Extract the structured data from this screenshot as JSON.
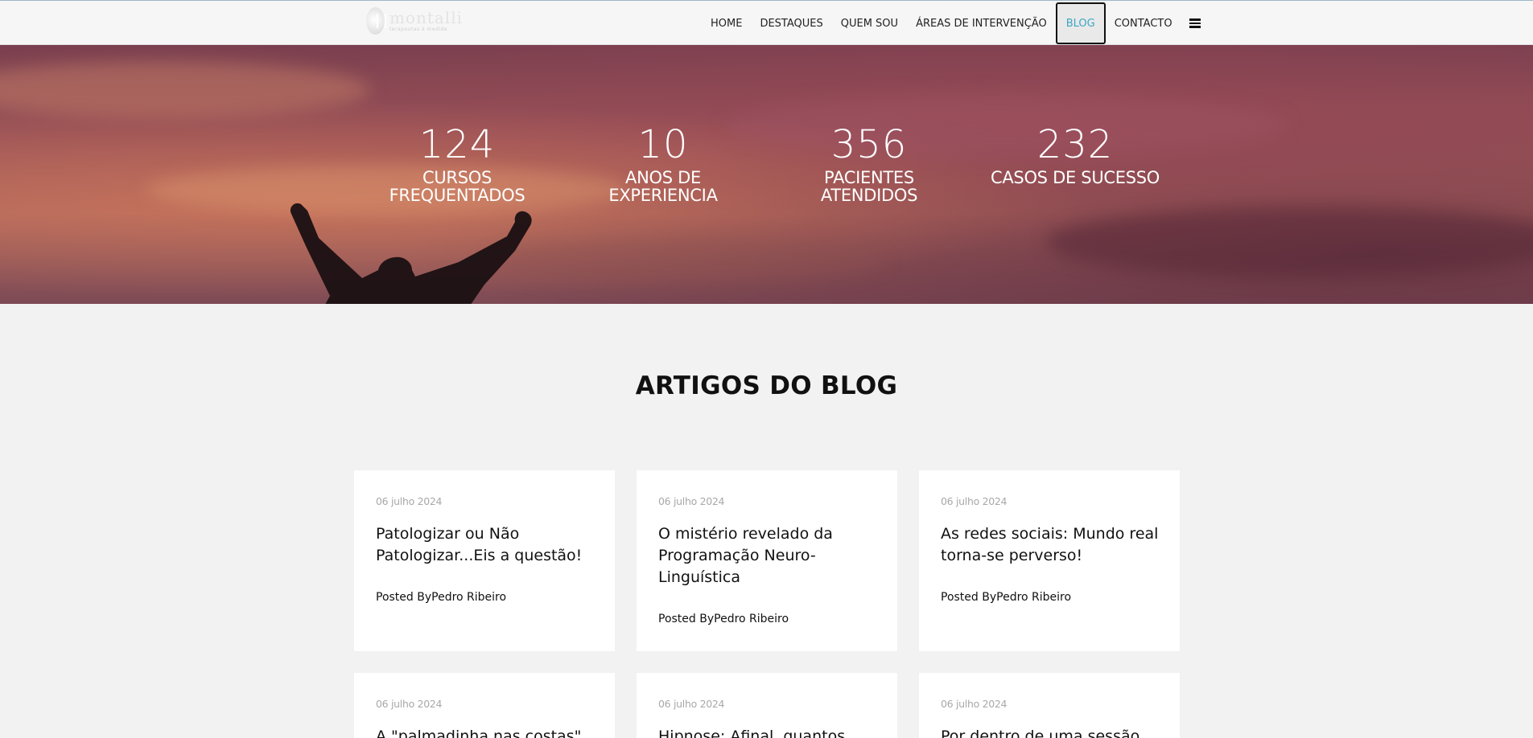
{
  "header": {
    "logo": {
      "name": "montalli",
      "tagline": "terapeutas à medida"
    },
    "nav": [
      {
        "label": "HOME",
        "active": false
      },
      {
        "label": "DESTAQUES",
        "active": false
      },
      {
        "label": "QUEM SOU",
        "active": false
      },
      {
        "label": "ÁREAS DE INTERVENÇÃO",
        "active": false
      },
      {
        "label": "BLOG",
        "active": true
      },
      {
        "label": "CONTACTO",
        "active": false
      }
    ],
    "menu_icon": "hamburger-menu-icon"
  },
  "hero": {
    "stats": [
      {
        "number": "124",
        "label_line1": "CURSOS",
        "label_line2": "FREQUENTADOS"
      },
      {
        "number": "10",
        "label_line1": "ANOS DE",
        "label_line2": "EXPERIENCIA"
      },
      {
        "number": "356",
        "label_line1": "PACIENTES",
        "label_line2": "ATENDIDOS"
      },
      {
        "number": "232",
        "label_line1": "CASOS DE SUCESSO",
        "label_line2": ""
      }
    ]
  },
  "blog": {
    "title": "ARTIGOS DO BLOG",
    "posts": [
      {
        "date": "06 julho 2024",
        "title": "Patologizar ou Não Patologizar...Eis a questão!",
        "author_prefix": "Posted By",
        "author": "Pedro Ribeiro"
      },
      {
        "date": "06 julho 2024",
        "title": "O mistério revelado da Programação Neuro-Linguística",
        "author_prefix": "Posted By",
        "author": "Pedro Ribeiro"
      },
      {
        "date": "06 julho 2024",
        "title": "As redes sociais: Mundo real torna-se perverso!",
        "author_prefix": "Posted By",
        "author": "Pedro Ribeiro"
      },
      {
        "date": "06 julho 2024",
        "title": "A \"palmadinha nas costas\"",
        "author_prefix": "",
        "author": ""
      },
      {
        "date": "06 julho 2024",
        "title": "Hipnose: Afinal, quantos",
        "author_prefix": "",
        "author": ""
      },
      {
        "date": "06 julho 2024",
        "title": "Por dentro de uma sessão",
        "author_prefix": "",
        "author": ""
      }
    ]
  },
  "colors": {
    "accent": "#3ba7c4",
    "page_bg": "#f2f2f2",
    "card_bg": "#ffffff"
  }
}
